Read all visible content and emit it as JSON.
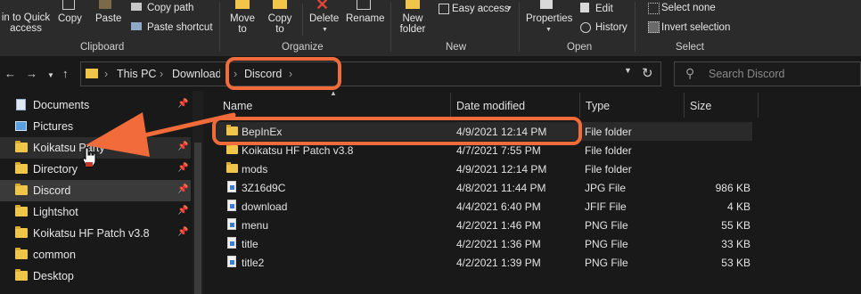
{
  "colors": {
    "accent": "#f26b3a",
    "folder": "#f0c54a",
    "background": "#191919",
    "ribbon": "#2b2b2b"
  },
  "ribbon": {
    "pin_quick_access": "in to Quick\naccess",
    "copy": "Copy",
    "paste": "Paste",
    "copy_path": "Copy path",
    "paste_shortcut": "Paste shortcut",
    "move_to": "Move\nto",
    "copy_to": "Copy\nto",
    "delete": "Delete",
    "rename": "Rename",
    "new_folder": "New\nfolder",
    "easy_access": "Easy access",
    "properties": "Properties",
    "edit": "Edit",
    "history": "History",
    "select_none": "Select none",
    "invert_selection": "Invert selection",
    "groups": {
      "clipboard": "Clipboard",
      "organize": "Organize",
      "new": "New",
      "open": "Open",
      "select": "Select"
    }
  },
  "address": {
    "crumbs": [
      "This PC",
      "Download",
      "Discord"
    ],
    "search_placeholder": "Search Discord"
  },
  "sidebar": {
    "items": [
      {
        "label": "Documents",
        "icon": "documents-icon",
        "pinned": true
      },
      {
        "label": "Pictures",
        "icon": "pictures-icon",
        "pinned": false
      },
      {
        "label": "Koikatsu Party",
        "icon": "folder-icon",
        "pinned": true,
        "state": "hover"
      },
      {
        "label": "Directory",
        "icon": "folder-icon",
        "pinned": true
      },
      {
        "label": "Discord",
        "icon": "folder-icon",
        "pinned": true,
        "state": "selected"
      },
      {
        "label": "Lightshot",
        "icon": "folder-icon",
        "pinned": true
      },
      {
        "label": "Koikatsu HF Patch v3.8",
        "icon": "folder-icon",
        "pinned": true
      },
      {
        "label": "common",
        "icon": "folder-icon",
        "pinned": false
      },
      {
        "label": "Desktop",
        "icon": "folder-icon",
        "pinned": false
      }
    ]
  },
  "columns": {
    "name": "Name",
    "date": "Date modified",
    "type": "Type",
    "size": "Size"
  },
  "files": [
    {
      "name": "BepInEx",
      "date": "4/9/2021 12:14 PM",
      "type": "File folder",
      "size": "",
      "icon": "folder-icon"
    },
    {
      "name": "Koikatsu HF Patch v3.8",
      "date": "4/7/2021 7:55 PM",
      "type": "File folder",
      "size": "",
      "icon": "folder-icon"
    },
    {
      "name": "mods",
      "date": "4/9/2021 12:14 PM",
      "type": "File folder",
      "size": "",
      "icon": "folder-icon"
    },
    {
      "name": "3Z16d9C",
      "date": "4/8/2021 11:44 PM",
      "type": "JPG File",
      "size": "986 KB",
      "icon": "image-file-icon"
    },
    {
      "name": "download",
      "date": "4/4/2021 6:40 PM",
      "type": "JFIF File",
      "size": "4 KB",
      "icon": "image-file-icon"
    },
    {
      "name": "menu",
      "date": "4/2/2021 1:46 PM",
      "type": "PNG File",
      "size": "55 KB",
      "icon": "image-file-icon"
    },
    {
      "name": "title",
      "date": "4/2/2021 1:36 PM",
      "type": "PNG File",
      "size": "33 KB",
      "icon": "image-file-icon"
    },
    {
      "name": "title2",
      "date": "4/2/2021 1:39 PM",
      "type": "PNG File",
      "size": "53 KB",
      "icon": "image-file-icon"
    }
  ]
}
